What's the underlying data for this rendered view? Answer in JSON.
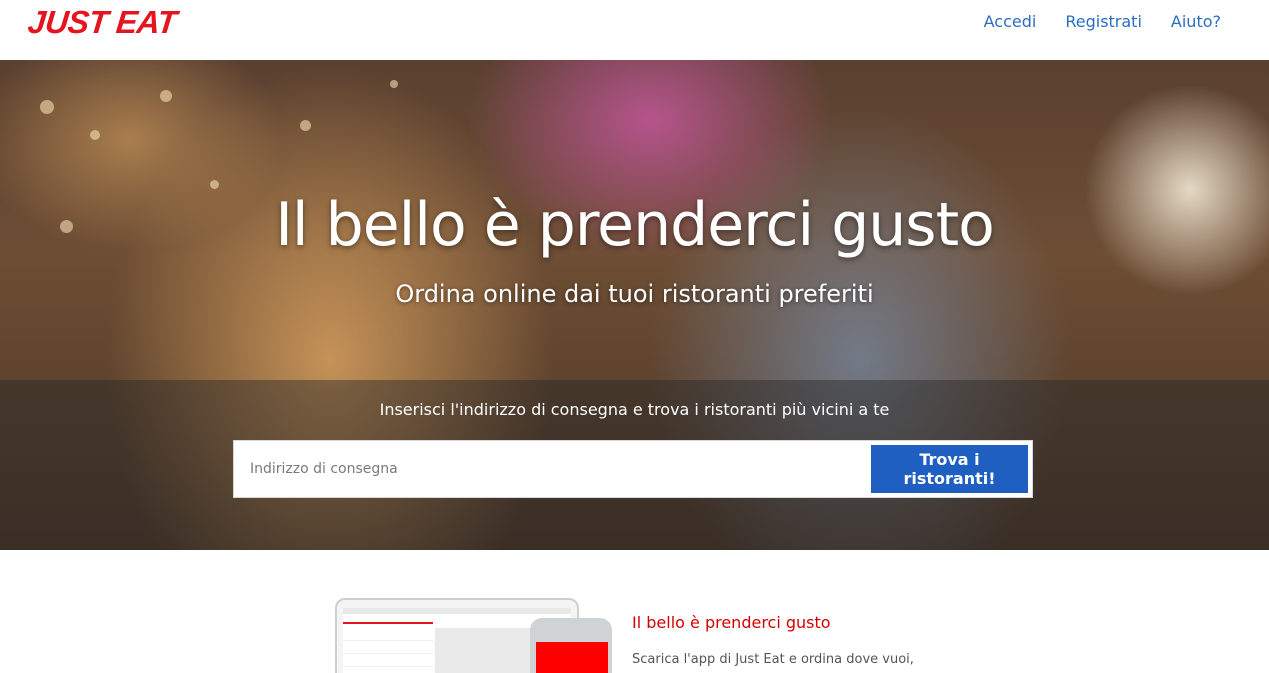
{
  "header": {
    "logo": "JUST EAT",
    "nav": [
      {
        "label": "Accedi"
      },
      {
        "label": "Registrati"
      },
      {
        "label": "Aiuto?"
      }
    ]
  },
  "hero": {
    "title": "Il bello è prenderci gusto",
    "subtitle": "Ordina online dai tuoi ristoranti preferiti",
    "search_prompt": "Inserisci l'indirizzo di consegna e trova i ristoranti più vicini a te",
    "search_placeholder": "Indirizzo di consegna",
    "search_button": "Trova i ristoranti!"
  },
  "promo": {
    "title": "Il bello è prenderci gusto",
    "text": "Scarica l'app di Just Eat e ordina dove vuoi,"
  },
  "colors": {
    "brand_red": "#e4151f",
    "link_blue": "#2a6ec1",
    "button_blue": "#1f5fc2"
  }
}
